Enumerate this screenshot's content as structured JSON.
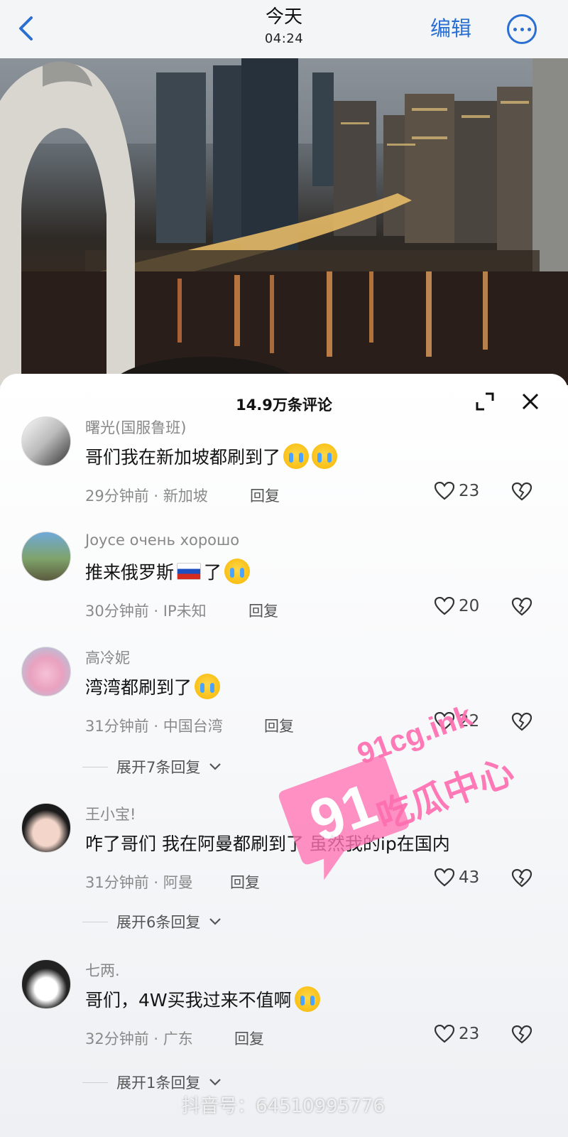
{
  "nav": {
    "title": "今天",
    "time": "04:24",
    "edit_label": "编辑",
    "back_icon": "chevron-left-icon",
    "more_icon": "more-icon",
    "accent": "#2a6fd1"
  },
  "panel": {
    "title": "14.9万条评论",
    "expand_icon": "expand-icon",
    "close_icon": "close-icon"
  },
  "comments": [
    {
      "username": "曙光(国服鲁班)",
      "text": "哥们我在新加坡都刷到了",
      "emoji_count": 2,
      "time": "29分钟前",
      "location": "新加坡",
      "reply_label": "回复",
      "likes": "23"
    },
    {
      "username": "Joyce очень хорошо",
      "text_before": "推来俄罗斯",
      "text_after": "了",
      "time": "30分钟前",
      "location": "IP未知",
      "reply_label": "回复",
      "likes": "20"
    },
    {
      "username": "高冷妮",
      "text": "湾湾都刷到了",
      "time": "31分钟前",
      "location": "中国台湾",
      "reply_label": "回复",
      "likes": "22",
      "expand_label": "展开7条回复"
    },
    {
      "username": "王小宝!",
      "text": "咋了哥们 我在阿曼都刷到了 虽然我的ip在国内",
      "time": "31分钟前",
      "location": "阿曼",
      "reply_label": "回复",
      "likes": "43",
      "expand_label": "展开6条回复"
    },
    {
      "username": "七两.",
      "text": "哥们，4W买我过来不值啊",
      "time": "32分钟前",
      "location": "广东",
      "reply_label": "回复",
      "likes": "23",
      "expand_label": "展开1条回复"
    }
  ],
  "watermark": {
    "logo_text": "91",
    "url_text": "91cg.ink",
    "brand_text": "吃瓜中心",
    "bottom_text": "抖音号：64510995776"
  }
}
